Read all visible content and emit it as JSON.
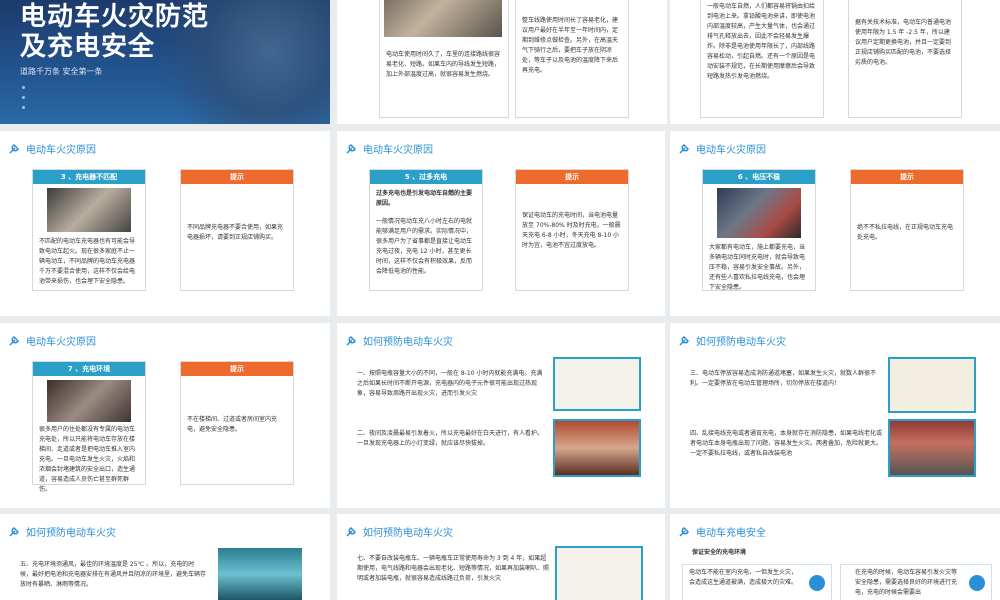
{
  "slide1": {
    "title_line1": "电动车火灾防范",
    "title_line2": "及充电安全",
    "subtitle": "道路千万条 安全第一条"
  },
  "slide2": {
    "left_text": "电动车使用时间久了，车里的连接路线很容易老化、短路。如果车内的导线发生短路，加上外部温度过高，就很容易发生燃烧。",
    "right_text": "整车线路使用时间长了容易老化，建议用户最好在半年至一年时间内，定期到维修点做检查。另外，在高温天气下骑行之后，要把车子放在阴凉处，等车子以及电池的温度降下来后再充电。"
  },
  "slide3": {
    "left_text": "一般电动车自燃，人们都容易将锅由扣给到电池上来。拿铅酸电池来讲，即使电池内部温度较高，产生大量气体，也会通过排气孔释放出去，因此不会轻易发生爆炸。除非是电池使用年限长了，内部线路容易松动，引起自燃。还有一个原因是电动安装不规范，在长期使用摩擦后会导致短路发热引发电池燃烧。",
    "right_text": "据有关技术标准，电动车内普通电池使用年限为 1.5 年 -2.5 年，所以建议用户定期更换电池，并且一定要到正规店铺购买匹配的电池，不要选择劣质的电池。"
  },
  "slide4": {
    "header": "电动车火灾原因",
    "card_title": "3 、充电器不匹配",
    "card_text": "不匹配的电动车充电器也有可能会导致电动车起火。现在很多家庭不止一辆电动车，不同品牌的电动车充电器千万不要混合使用，这样不仅会给电池带来损伤，也会埋下安全隐患。",
    "tip_title": "提示",
    "tip_text": "不同品牌充电器不要合使用，如果充电器损坏，请要到正规店铺购买。"
  },
  "slide5": {
    "header": "电动车火灾原因",
    "card_title": "5 、过多充电",
    "card_bold": "过多充电也是引发电动车自燃的主要原因。",
    "card_text": "一般情况电动车充八小时左右的电就能够满足用户的需求。实际情况中，很多用户为了省事都是直接让电动车充电过夜，充电 12 小时，甚至更长时间，这样不仅会有积极效果，反而会降低电池的性能。",
    "tip_title": "提示",
    "tip_text": "保证电动车的充电时间，当电池电量放至 70%-80% 时及时充电，一般晨天充电 6-8 小时，冬天充电 8-10 小时为宜，电池不宜过度放电。"
  },
  "slide6": {
    "header": "电动车火灾原因",
    "card_title": "6 、电压不稳",
    "card_text": "大家都有电动车，施上都要充电，当多辆电动车同时充电时，就会导致电压不稳，容易引发安全事故。另外，还有些人喜欢私拉电线充电，也会埋下安全隐患。",
    "tip_title": "提示",
    "tip_text": "绝不不私拉电线，在正规电动车充电处充电。"
  },
  "slide7": {
    "header": "电动车火灾原因",
    "card_title": "7 、充电环境",
    "card_text": "很多用户的住处都没有专属的电动车充电处，所以只能将电动车存放在楼梯间、走道或者是把电动车推入室内充电。一旦电动车发生火灾，火焰和浓烟会封堵建筑的安全出口，造生通道，容易造成人员伤亡甚至群死群伤。",
    "tip_title": "提示",
    "tip_text": "不在楼梯间、过道或者房间室内充电，避免安全隐患。"
  },
  "slide8": {
    "header": "如何预防电动车火灾",
    "p1": "一、按照电瓶容量大小的不同，一般在 8-10 小时内就能充满电。充满之后如果长时间不断开电源，充电器内的电子元件很可能出现过热现象，容易导致周路开出现火灾，进而引发火灾",
    "p2": "二、夜间及凌晨最易引发着火，所以充电最好在白天进行，有人看护。一旦发现充电器上的小灯变绿，就应该尽快拔掉。"
  },
  "slide9": {
    "header": "如何预防电动车火灾",
    "p1": "三、电动车停放容易造成消防通道堵塞，如果发生火灾，就数人群很不利。一定要停放在电动车管理场所，切勿停放在楼道内！",
    "p2": "四、乱接电线充电或者通宵充电，本身就存在消防隐患，如果电线老化或者电动车本身电瓶出现了问题，容易发生火灾。两者叠加，危险就更大。一定不要私拉电线，或者私自改装电池"
  },
  "slide10": {
    "header": "如何预防电动车火灾",
    "p1": "五、充电环境须通风，最佳的环境温度是 25℃ 。所以，充电的时候，最好把电池和充电器安排在有通风并且阴凉的环境里，避免车辆存放时有暴晒、淋雨等情况。"
  },
  "slide11": {
    "header": "如何预防电动车火灾",
    "p1": "七、不要自改装电瓶车。一辆电瓶车正常使用寿命为 3 到 4 年，如果超期使用，电气线路和电器会出现老化、短路等情况，如果再加装喇叭、照明或者加装电瓶，就很容易造成线路过负荷，引发火灾"
  },
  "slide12": {
    "header": "电动车充电安全",
    "section_title": "保证安全的充电环境",
    "box1_text": "电动车不能在室内充电，一但发生火灾，会造成这生通道被满，造成极大的灾难。",
    "box2_text": "在充电的时候，电动车容易引发火灾等安全隐患，需要选择良好的环境进行充电，充电的时候会需要出"
  },
  "colors": {
    "accent_blue": "#2aa0c8",
    "accent_orange": "#ec6b2d",
    "header_blue": "#2a8fd6",
    "title_bg": "#1d3a6b"
  }
}
